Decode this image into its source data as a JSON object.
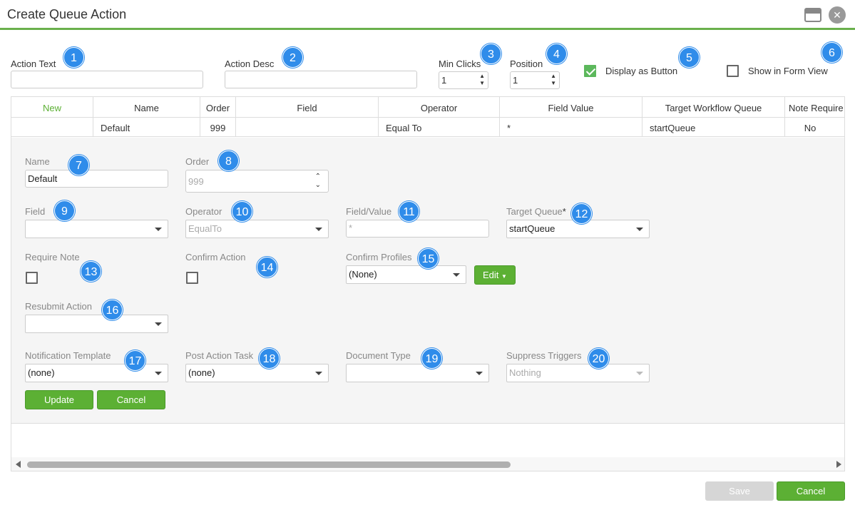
{
  "window": {
    "title": "Create Queue Action"
  },
  "top": {
    "action_text_label": "Action Text",
    "action_desc_label": "Action Desc",
    "min_clicks_label": "Min Clicks",
    "min_clicks_value": "1",
    "position_label": "Position",
    "position_value": "1",
    "display_as_button_label": "Display as Button",
    "display_as_button_checked": true,
    "show_in_form_view_label": "Show in Form View",
    "show_in_form_view_checked": false
  },
  "grid": {
    "columns": [
      "New",
      "Name",
      "Order",
      "Field",
      "Operator",
      "Field Value",
      "Target Workflow Queue",
      "Note Require"
    ],
    "row": [
      "",
      "Default",
      "999",
      "",
      "Equal To",
      "*",
      "startQueue",
      "No"
    ]
  },
  "form": {
    "name_label": "Name",
    "name_value": "Default",
    "order_label": "Order",
    "order_value": "999",
    "field_label": "Field",
    "field_value": "",
    "operator_label": "Operator",
    "operator_value": "EqualTo",
    "field_value_label": "Field/Value",
    "field_value_placeholder": "*",
    "target_queue_label": "Target Queue",
    "target_queue_required": "*",
    "target_queue_value": "startQueue",
    "require_note_label": "Require Note",
    "confirm_action_label": "Confirm Action",
    "confirm_profiles_label": "Confirm Profiles",
    "confirm_profiles_value": "(None)",
    "edit_button": "Edit",
    "resubmit_action_label": "Resubmit Action",
    "resubmit_action_value": "",
    "notification_template_label": "Notification Template",
    "notification_template_value": "(none)",
    "post_action_task_label": "Post Action Task",
    "post_action_task_value": "(none)",
    "document_type_label": "Document Type",
    "document_type_value": "",
    "suppress_triggers_label": "Suppress Triggers",
    "suppress_triggers_value": "Nothing",
    "update_button": "Update",
    "cancel_button": "Cancel"
  },
  "footer": {
    "save_button": "Save",
    "cancel_button": "Cancel"
  },
  "badges": [
    "1",
    "2",
    "3",
    "4",
    "5",
    "6",
    "7",
    "8",
    "9",
    "10",
    "11",
    "12",
    "13",
    "14",
    "15",
    "16",
    "17",
    "18",
    "19",
    "20"
  ],
  "colors": {
    "accent_green": "#5cb034",
    "badge_blue": "#2f8cea",
    "new_link": "#5cb034"
  }
}
